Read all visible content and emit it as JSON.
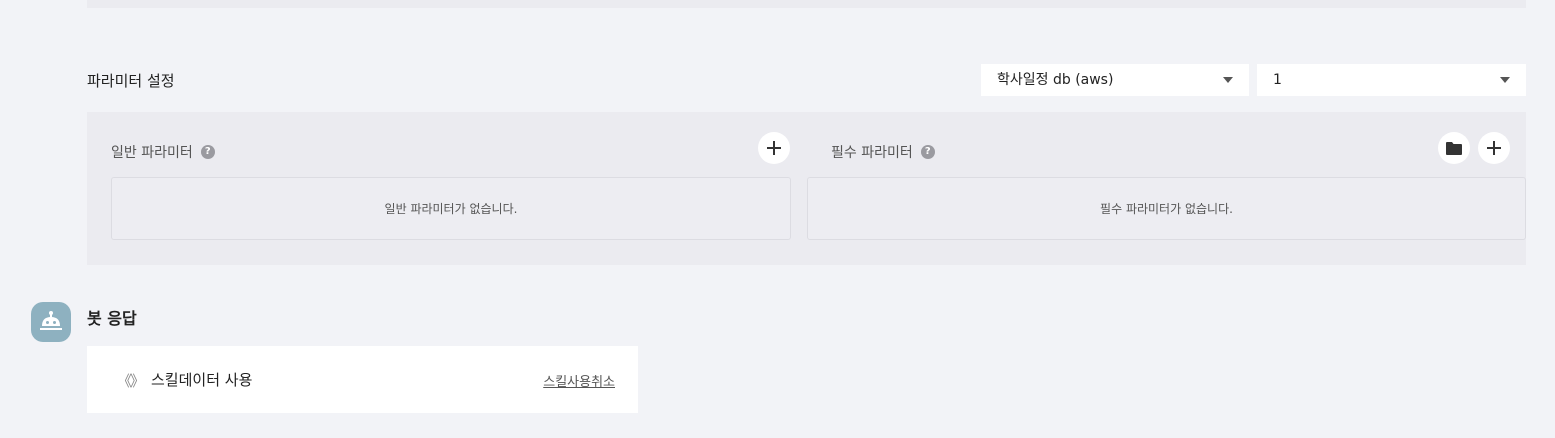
{
  "params_section": {
    "title": "파라미터 설정",
    "db_select": {
      "value": "학사일정 db (aws)"
    },
    "version_select": {
      "value": "1"
    },
    "general": {
      "label": "일반 파라미터",
      "empty_text": "일반 파라미터가 없습니다."
    },
    "required": {
      "label": "필수 파라미터",
      "empty_text": "필수 파라미터가 없습니다."
    },
    "help_glyph": "?"
  },
  "bot_response": {
    "title": "봇 응답",
    "skill_icon_glyph": "《》",
    "skill_text": "스킬데이터 사용",
    "cancel_link": "스킬사용취소"
  },
  "colors": {
    "page_bg": "#f2f3f7",
    "panel_bg": "#ebebf0",
    "avatar_bg": "#8eb1c0"
  },
  "icons": [
    "chevron-down-icon",
    "help-icon",
    "plus-icon",
    "folder-icon",
    "robot-icon",
    "code-brackets-icon"
  ]
}
